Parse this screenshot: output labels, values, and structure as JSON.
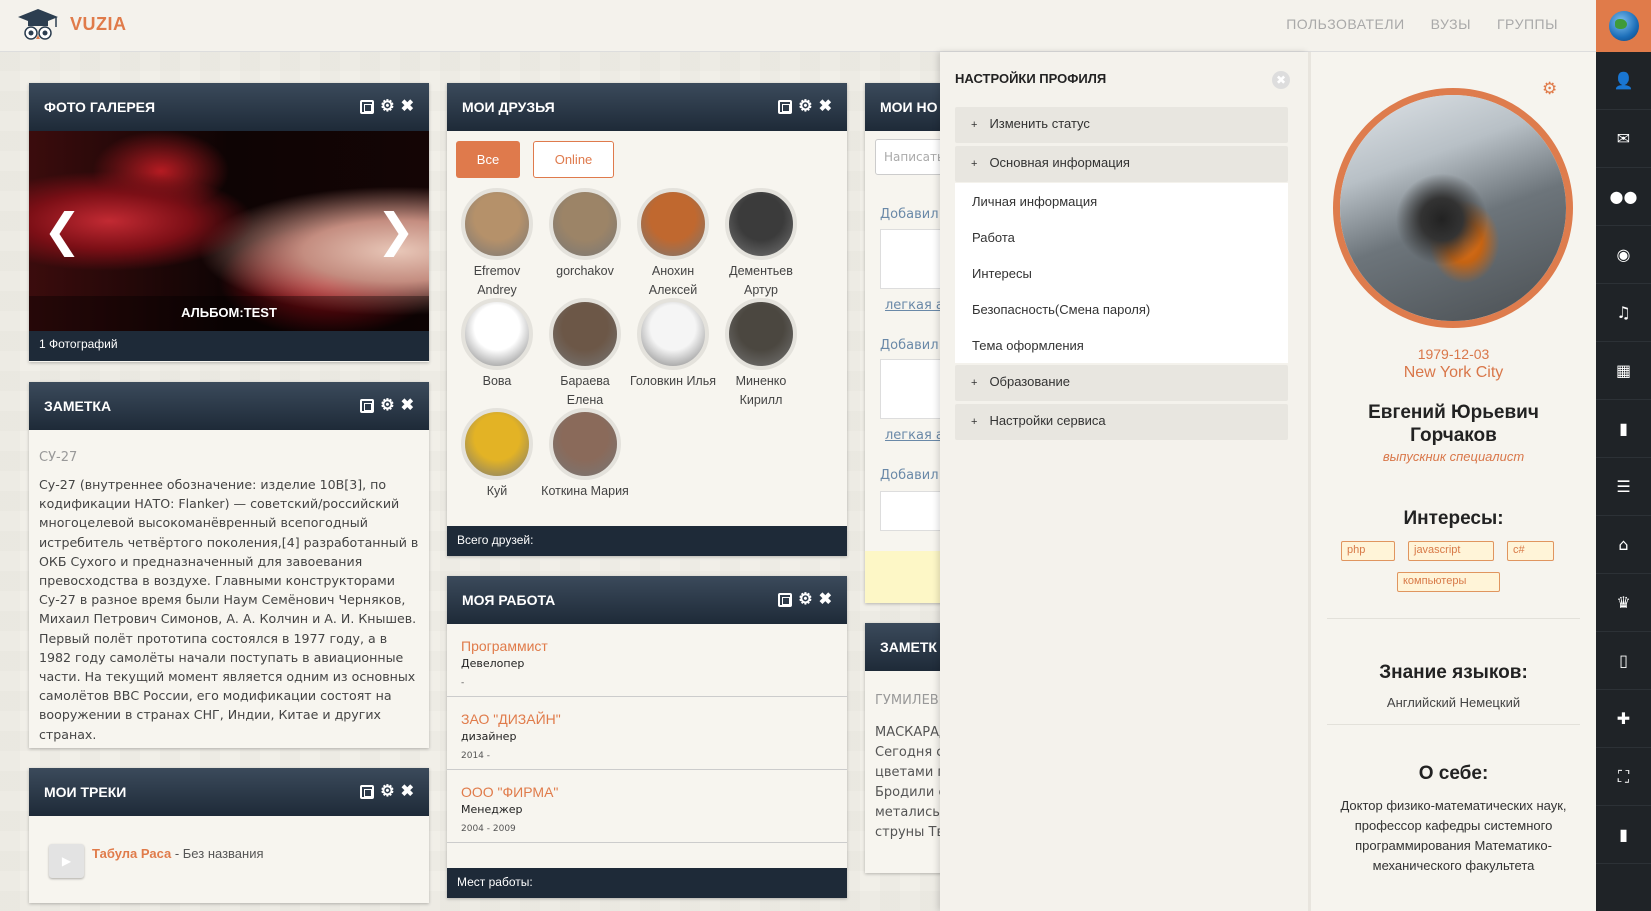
{
  "brand": {
    "name": "VUZIA"
  },
  "nav": {
    "users": "ПОЛЬЗОВАТЕЛИ",
    "vuzy": "ВУЗЫ",
    "groups": "ГРУППЫ"
  },
  "gallery": {
    "title": "ФОТО ГАЛЕРЕЯ",
    "album": "АЛЬБОМ:TEST",
    "count": "1 Фотографий"
  },
  "note": {
    "header": "ЗАМЕТКА",
    "title": "СУ-27",
    "text": "Су-27 (внутреннее обозначение: изделие 10В[3], по кодификации НАТО: Flanker) — советский/российский многоцелевой высокоманёвренный всепогодный истребитель четвёртого поколения,[4] разработанный в ОКБ Сухого и предназначенный для завоевания превосходства в воздухе. Главными конструкторами Су-27 в разное время были Наум Семёнович Черняков, Михаил Петрович Симонов, А. А. Колчин и А. И. Кнышев. Первый полёт прототипа состоялся в 1977 году, а в 1982 году самолёты начали поступать в авиационные части. На текущий момент является одним из основных самолётов ВВС России, его модификации состоят на вооружении в странах СНГ, Индии, Китае и других странах."
  },
  "tracks": {
    "header": "МОИ ТРЕКИ",
    "artist": "Табула Раса",
    "song": " - Без названия"
  },
  "friends": {
    "header": "МОИ ДРУЗЬЯ",
    "tab_all": "Все",
    "tab_online": "Online",
    "footer": "Всего друзей:",
    "list": [
      {
        "name": "Efremov Andrey",
        "color": "#b5916a"
      },
      {
        "name": "gorchakov",
        "color": "#9c8467"
      },
      {
        "name": "Анохин Алексей",
        "color": "#c0682f"
      },
      {
        "name": "Дементьев Артур",
        "color": "#3b3b3b"
      },
      {
        "name": "Вова",
        "color": "#ffffff"
      },
      {
        "name": "Бараева Елена",
        "color": "#6c5747"
      },
      {
        "name": "Головкин Илья",
        "color": "#f5f5f5"
      },
      {
        "name": "Миненко Кирилл",
        "color": "#4b4740"
      },
      {
        "name": "Куй",
        "color": "#e3b325"
      },
      {
        "name": "Коткина Мария",
        "color": "#8a6a5a"
      }
    ]
  },
  "work": {
    "header": "МОЯ РАБОТА",
    "jobs": [
      {
        "company": "Программист",
        "role": "Девелопер",
        "years": "-"
      },
      {
        "company": "ЗАО \"ДИЗАЙН\"",
        "role": "дизайнер",
        "years": "2014 -"
      },
      {
        "company": "ООО \"ФИРМА\"",
        "role": "Менеджер",
        "years": "2004 - 2009"
      }
    ],
    "footer": "Мест работы:"
  },
  "news": {
    "header": "МОИ НО",
    "placeholder": "Написать",
    "added": [
      "Добавил",
      "Добавил",
      "Добавил"
    ],
    "links": [
      "легкая а",
      "легкая а"
    ]
  },
  "note2": {
    "header": "ЗАМЕТК",
    "title": "ГУМИЛЕВ",
    "lines": [
      "МАСКАРАД",
      "Сегодня с",
      "цветами г",
      "Бродили с",
      "металисы",
      "струны Тв"
    ]
  },
  "settings": {
    "title": "НАСТРОЙКИ ПРОФИЛЯ",
    "change_status": "Изменить статус",
    "basic_info": "Основная информация",
    "sub": [
      "Личная информация",
      "Работа",
      "Интересы",
      "Безопасность(Смена пароля)",
      "Тема оформления"
    ],
    "education": "Образование",
    "service": "Настройки сервиса"
  },
  "profile": {
    "birth": "1979-12-03",
    "city": "New York City",
    "name_line1": "Евгений Юрьевич",
    "name_line2": "Горчаков",
    "status": "выпускник специалист",
    "interests_title": "Интересы:",
    "interests": [
      "php",
      "javascript",
      "c#",
      "компьютеры"
    ],
    "languages_title": "Знание языков:",
    "languages": "Английский Немецкий",
    "about_title": "О себе:",
    "about": "Доктор физико-математических наук, профессор кафедры системного программирования Математико-механического факультета"
  },
  "sidebar_icons": [
    "user-icon",
    "mail-icon",
    "group-icon",
    "camera-icon",
    "music-icon",
    "film-icon",
    "book-icon",
    "list-icon",
    "home-icon",
    "trophy-icon",
    "mouse-icon",
    "plus-icon",
    "fullscreen-icon",
    "lock-icon"
  ],
  "colors": {
    "accent": "#e07b4a",
    "dark": "#1f2327",
    "header": "#1e2a38"
  }
}
